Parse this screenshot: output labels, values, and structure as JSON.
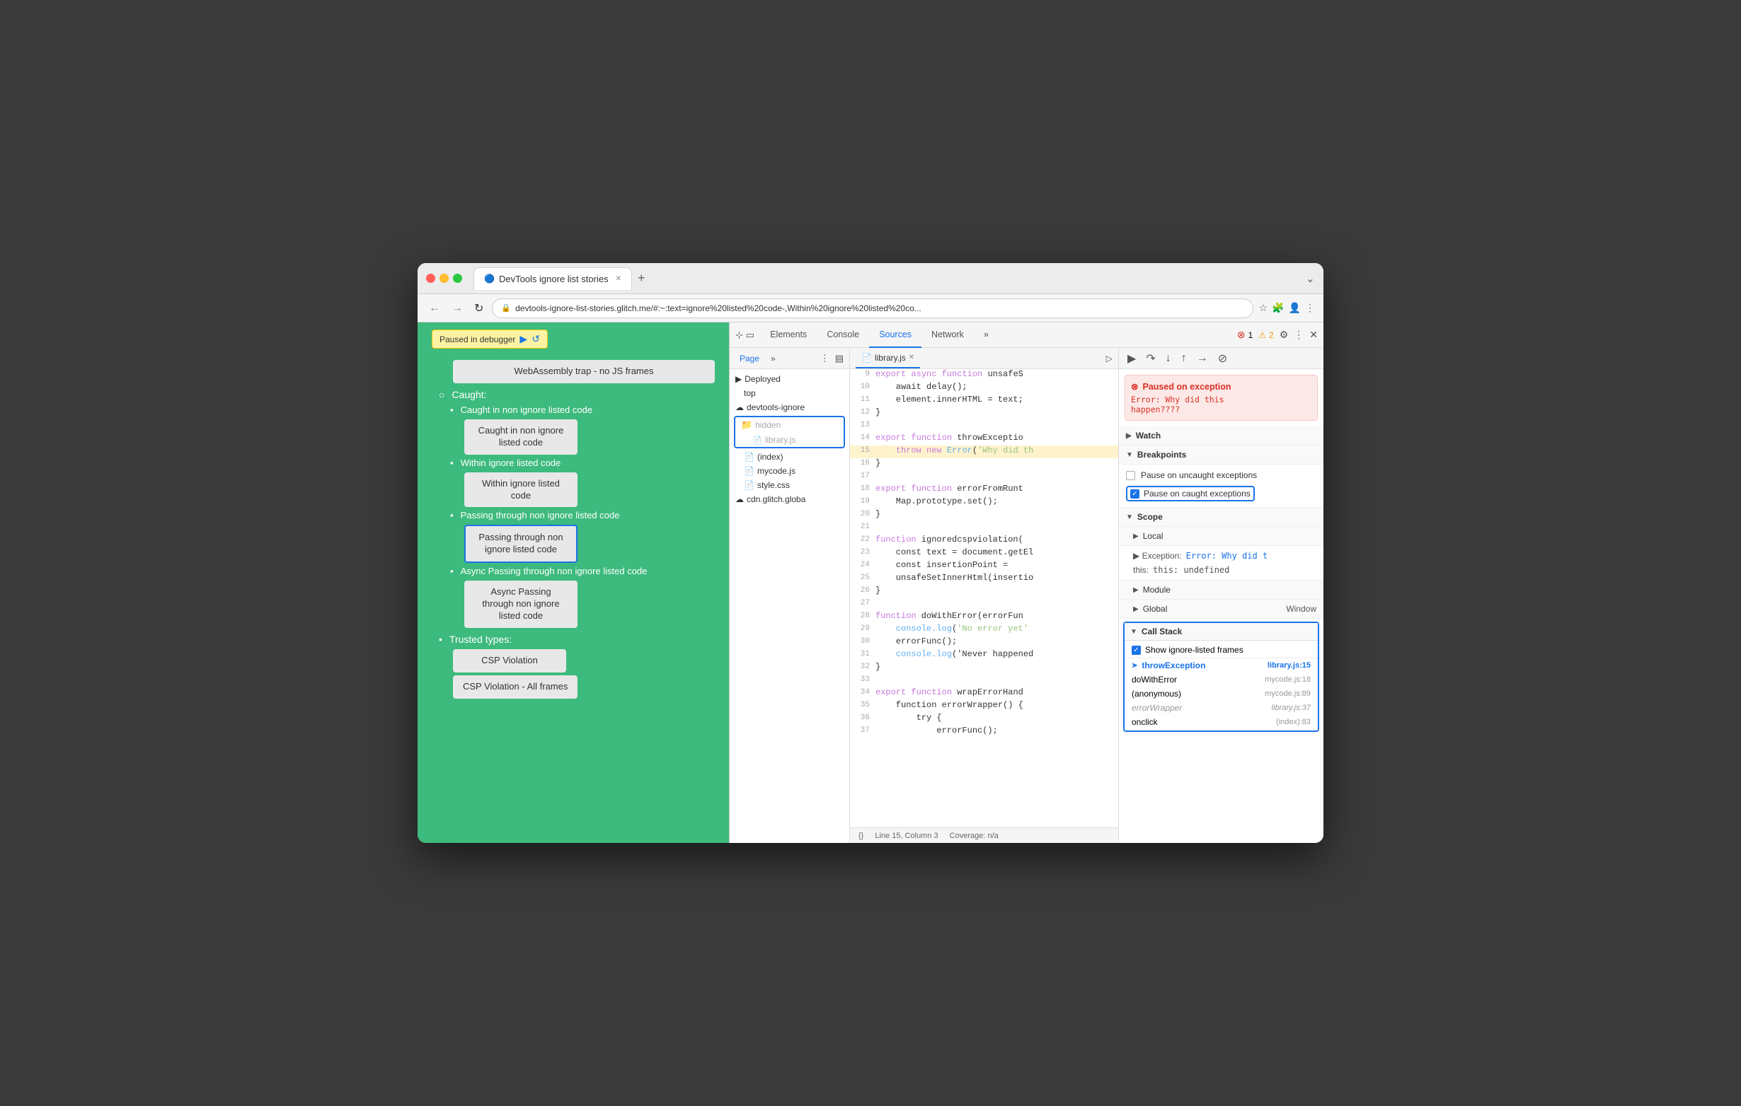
{
  "browser": {
    "tab_title": "DevTools ignore list stories",
    "tab_icon": "🔵",
    "address": "devtools-ignore-list-stories.glitch.me/#:~:text=ignore%20listed%20code-,Within%20ignore%20listed%20co...",
    "nav_more": "⌄"
  },
  "webpage": {
    "paused_label": "Paused in debugger",
    "webassembly_item": "WebAssembly trap - no JS frames",
    "caught_section": "Caught:",
    "caught_items": [
      {
        "label": "Caught in non ignore listed code",
        "btn_label": "Caught in non ignore\nlisted code"
      }
    ],
    "within_section": "Within ignore listed code",
    "within_btn": "Within ignore listed\ncode",
    "passing_section": "Passing through non ignore listed code",
    "passing_btn": "Passing through non\nignore listed code",
    "async_section": "Async Passing through\nnon ignore listed code",
    "async_btn": "Async Passing\nthrough non ignore\nlisted code",
    "trusted_section": "Trusted types:",
    "csp_btn1": "CSP Violation",
    "csp_btn2": "CSP Violation - All frames"
  },
  "devtools": {
    "tabs": [
      "Elements",
      "Console",
      "Sources",
      "Network"
    ],
    "active_tab": "Sources",
    "error_count": "1",
    "warn_count": "2",
    "sources_subtabs": [
      "Page",
      "»"
    ],
    "active_subtab": "Page",
    "file_tree": {
      "deployed": "Deployed",
      "top": "top",
      "devtools_ignore": "devtools-ignore",
      "hidden": "hidden",
      "library_js": "library.js",
      "index": "(index)",
      "mycode_js": "mycode.js",
      "style_css": "style.css",
      "cdn_glitch": "cdn.glitch.globa"
    },
    "editor": {
      "filename": "library.js",
      "lines": [
        {
          "num": 9,
          "content": "export async function unsafeS",
          "highlight": false
        },
        {
          "num": 10,
          "content": "    await delay();",
          "highlight": false
        },
        {
          "num": 11,
          "content": "    element.innerHTML = text;",
          "highlight": false
        },
        {
          "num": 12,
          "content": "}",
          "highlight": false
        },
        {
          "num": 13,
          "content": "",
          "highlight": false
        },
        {
          "num": 14,
          "content": "export function throwExceptio",
          "highlight": false
        },
        {
          "num": 15,
          "content": "    throw new Error('Why did th",
          "highlight": true
        },
        {
          "num": 16,
          "content": "}",
          "highlight": false
        },
        {
          "num": 17,
          "content": "",
          "highlight": false
        },
        {
          "num": 18,
          "content": "export function errorFromRunt",
          "highlight": false
        },
        {
          "num": 19,
          "content": "    Map.prototype.set();",
          "highlight": false
        },
        {
          "num": 20,
          "content": "}",
          "highlight": false
        },
        {
          "num": 21,
          "content": "",
          "highlight": false
        },
        {
          "num": 22,
          "content": "function ignoredcspviolation(",
          "highlight": false
        },
        {
          "num": 23,
          "content": "    const text = document.getEl",
          "highlight": false
        },
        {
          "num": 24,
          "content": "    const insertionPoint = ",
          "highlight": false
        },
        {
          "num": 25,
          "content": "    unsafeSetInnerHtml(insertio",
          "highlight": false
        },
        {
          "num": 26,
          "content": "}",
          "highlight": false
        },
        {
          "num": 27,
          "content": "",
          "highlight": false
        },
        {
          "num": 28,
          "content": "function doWithError(errorFun",
          "highlight": false
        },
        {
          "num": 29,
          "content": "    console.log('No error yet'",
          "highlight": false
        },
        {
          "num": 30,
          "content": "    errorFunc();",
          "highlight": false
        },
        {
          "num": 31,
          "content": "    console.log('Never happened",
          "highlight": false
        },
        {
          "num": 32,
          "content": "}",
          "highlight": false
        },
        {
          "num": 33,
          "content": "",
          "highlight": false
        },
        {
          "num": 34,
          "content": "export function wrapErrorHand",
          "highlight": false
        },
        {
          "num": 35,
          "content": "    function errorWrapper() {",
          "highlight": false
        },
        {
          "num": 36,
          "content": "        try {",
          "highlight": false
        },
        {
          "num": 37,
          "content": "            errorFunc();",
          "highlight": false
        }
      ],
      "status_line": "Line 15, Column 3",
      "coverage": "Coverage: n/a"
    },
    "right_panel": {
      "paused_exception": {
        "title": "⊗ Paused on exception",
        "message": "Error: Why did this\nhappen????"
      },
      "watch_label": "Watch",
      "breakpoints_label": "Breakpoints",
      "pause_uncaught": "Pause on uncaught exceptions",
      "pause_caught": "Pause on caught exceptions",
      "scope_label": "Scope",
      "local_label": "Local",
      "exception_val": "Exception: Error: Why did t",
      "this_val": "this: undefined",
      "module_label": "Module",
      "global_label": "Global",
      "global_val": "Window",
      "call_stack_label": "Call Stack",
      "show_ignored": "Show ignore-listed frames",
      "stack_frames": [
        {
          "fn": "throwException",
          "loc": "library.js:15",
          "active": true,
          "ignored": false
        },
        {
          "fn": "doWithError",
          "loc": "mycode.js:18",
          "active": false,
          "ignored": false
        },
        {
          "fn": "(anonymous)",
          "loc": "mycode.js:89",
          "active": false,
          "ignored": false
        },
        {
          "fn": "errorWrapper",
          "loc": "library.js:37",
          "active": false,
          "ignored": true
        },
        {
          "fn": "onclick",
          "loc": "(index):83",
          "active": false,
          "ignored": false
        }
      ]
    }
  }
}
